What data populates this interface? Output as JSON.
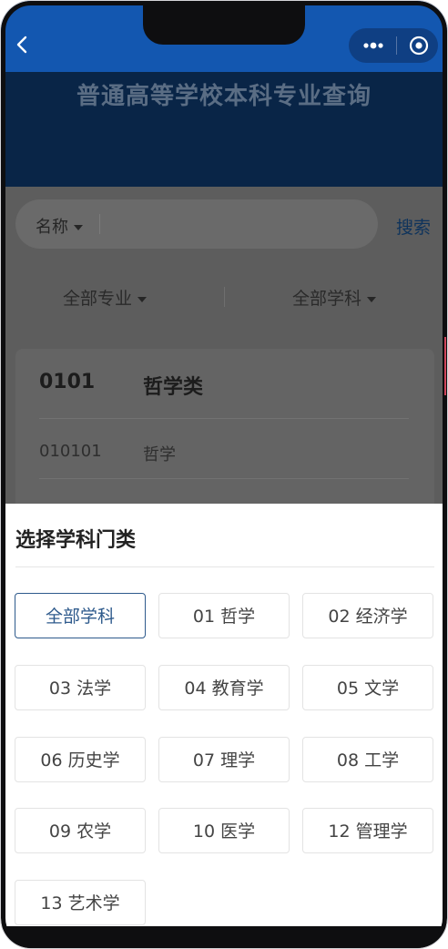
{
  "page": {
    "title": "普通高等学校本科专业查询"
  },
  "colors": {
    "navbar": "#1357b0",
    "accent": "#2e5a8c"
  },
  "icons": {
    "back": "back-chevron-icon",
    "more": "more-dots-icon",
    "close": "target-circle-icon"
  },
  "search": {
    "field_label": "名称",
    "button_label": "搜索"
  },
  "filters": {
    "major": "全部专业",
    "subject": "全部学科"
  },
  "card": {
    "code": "0101",
    "category": "哲学类",
    "items": [
      {
        "code": "010101",
        "name": "哲学"
      }
    ]
  },
  "sheet": {
    "title": "选择学科门类",
    "selected_index": 0,
    "options": [
      "全部学科",
      "01 哲学",
      "02 经济学",
      "03 法学",
      "04 教育学",
      "05 文学",
      "06 历史学",
      "07 理学",
      "08 工学",
      "09 农学",
      "10 医学",
      "12 管理学",
      "13 艺术学"
    ]
  }
}
